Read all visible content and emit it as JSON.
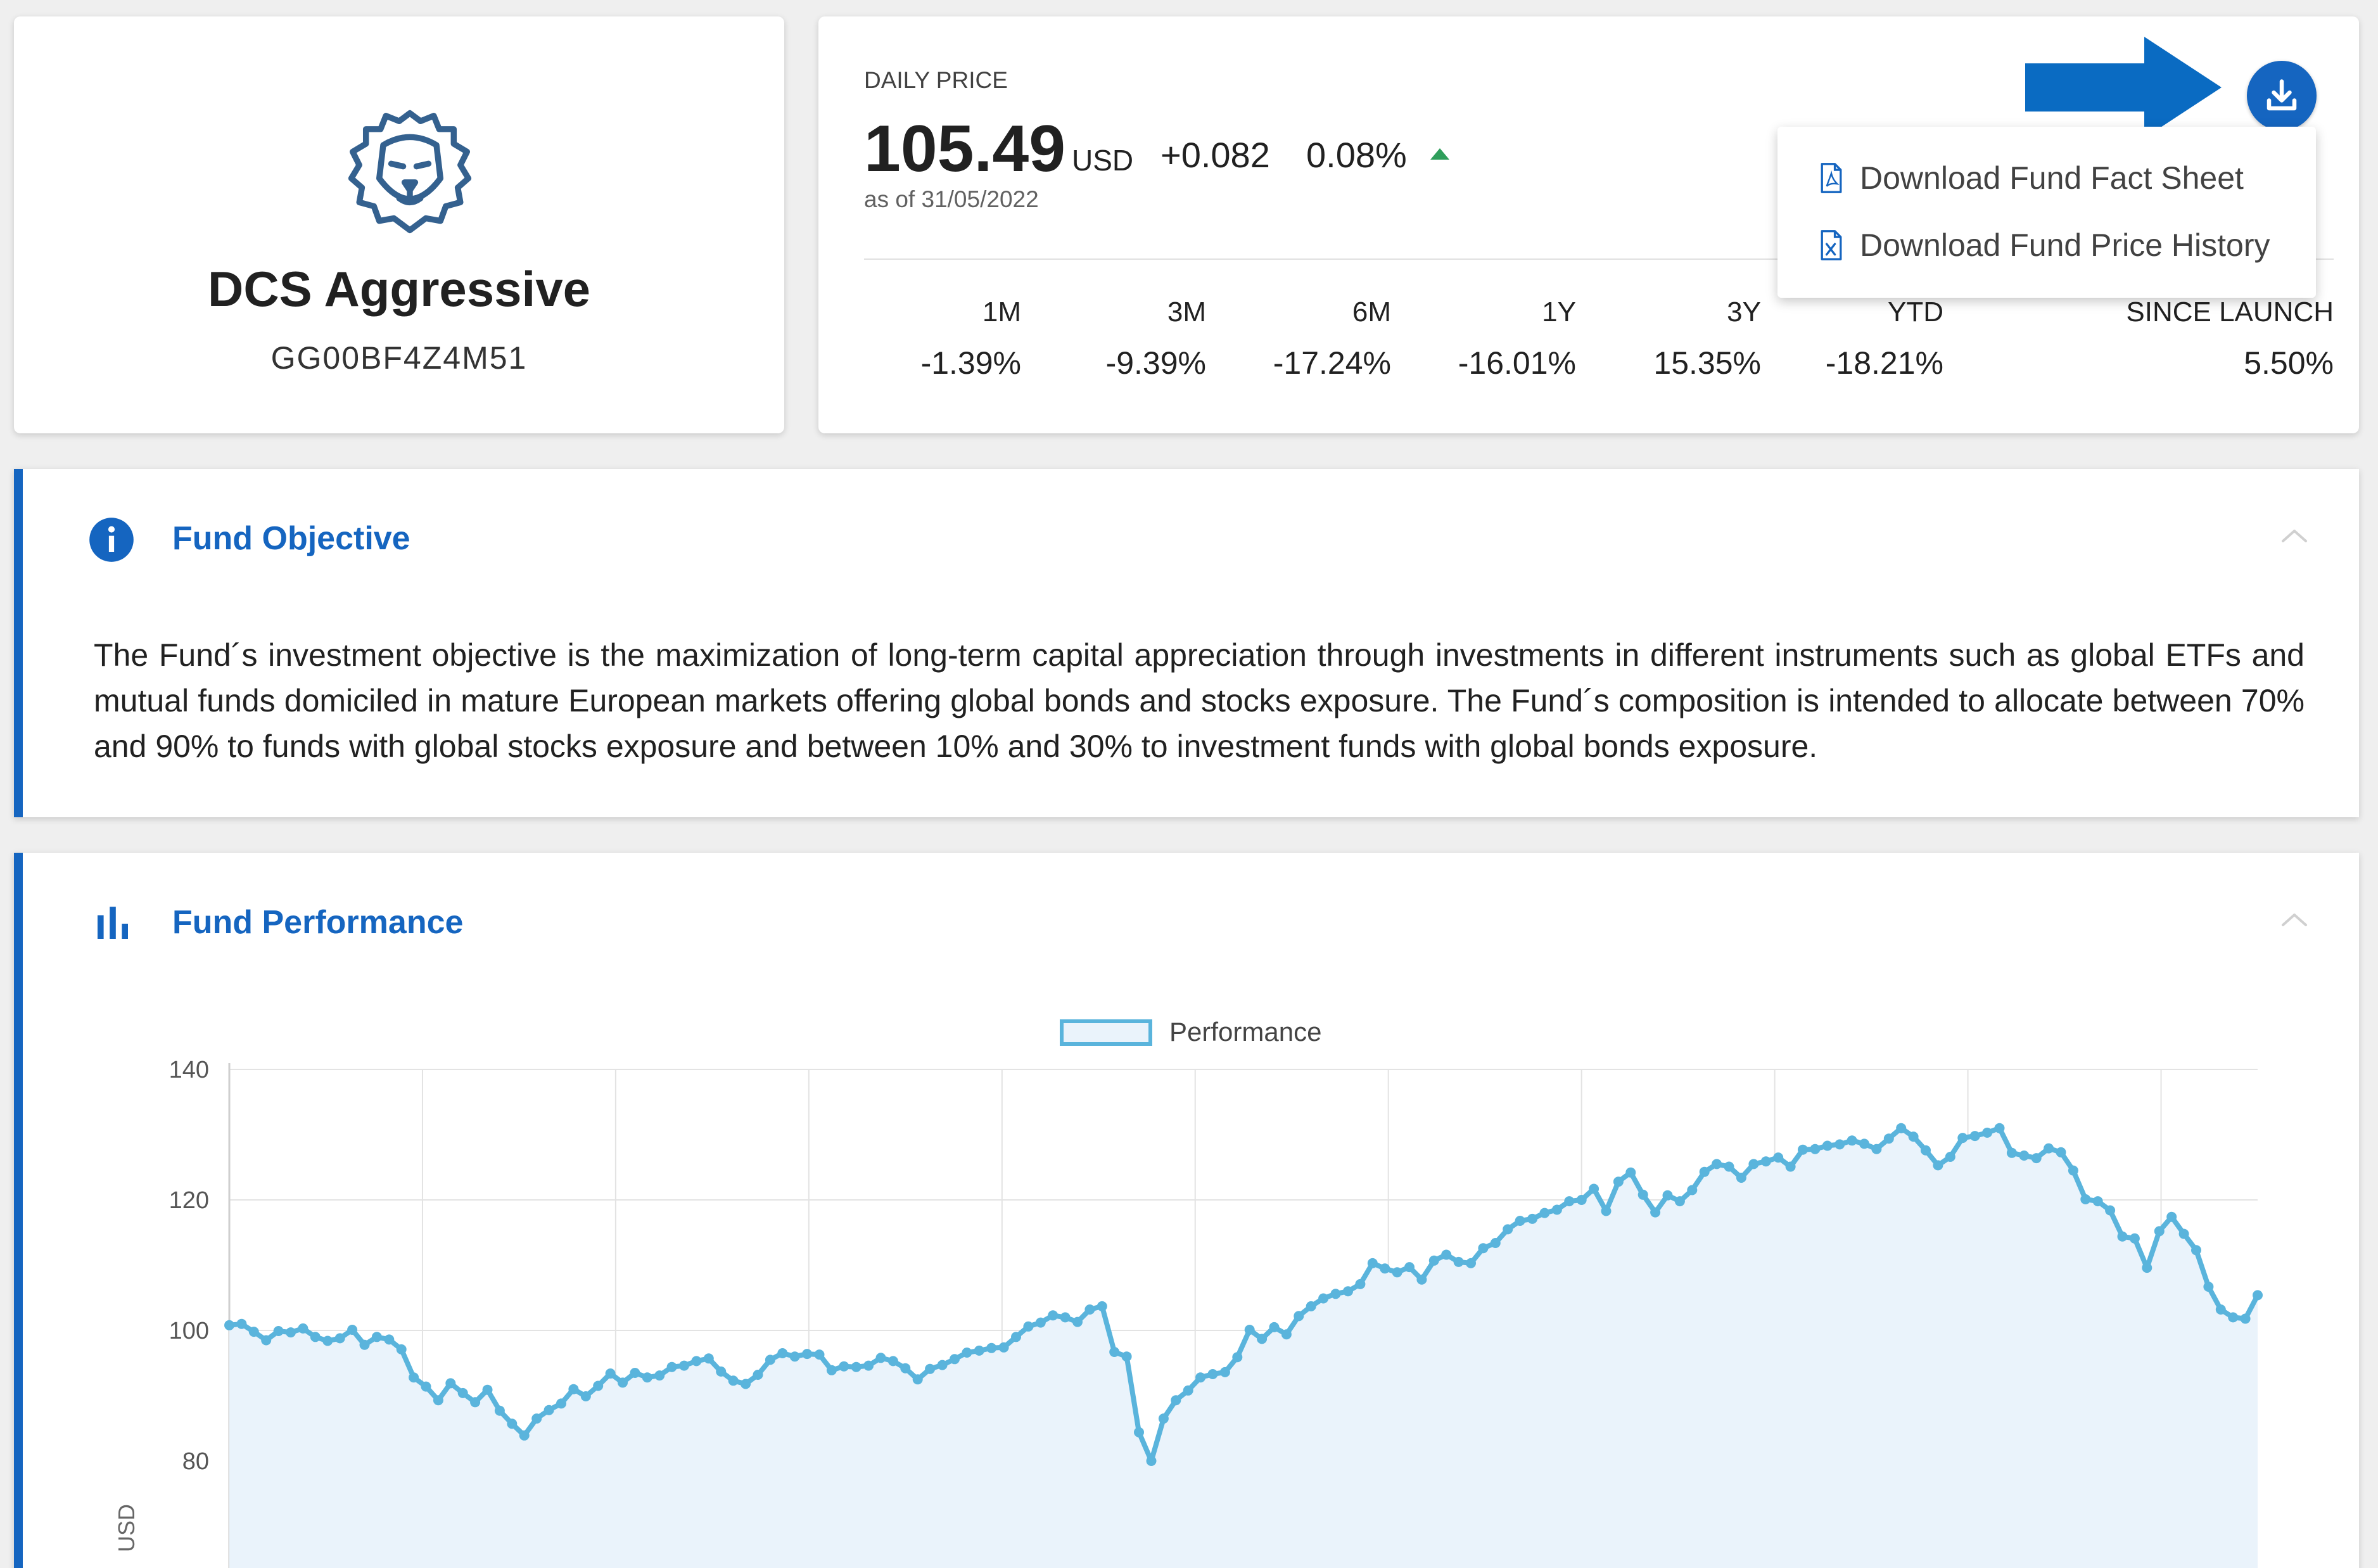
{
  "fund": {
    "name": "DCS Aggressive",
    "isin": "GG00BF4Z4M51"
  },
  "price": {
    "label": "DAILY PRICE",
    "value": "105.49",
    "currency": "USD",
    "change": "+0.082",
    "change_pct": "0.08%",
    "as_of": "as of 31/05/2022",
    "trend": "up"
  },
  "performance_summary": [
    {
      "label": "1M",
      "value": "-1.39%"
    },
    {
      "label": "3M",
      "value": "-9.39%"
    },
    {
      "label": "6M",
      "value": "-17.24%"
    },
    {
      "label": "1Y",
      "value": "-16.01%"
    },
    {
      "label": "3Y",
      "value": "15.35%"
    },
    {
      "label": "YTD",
      "value": "-18.21%"
    },
    {
      "label": "SINCE LAUNCH",
      "value": "5.50%"
    }
  ],
  "download_menu": {
    "button_icon": "download-icon",
    "items": [
      {
        "label": "Download Fund Fact Sheet",
        "icon": "pdf-file-icon"
      },
      {
        "label": "Download Fund Price History",
        "icon": "excel-file-icon"
      }
    ]
  },
  "objective": {
    "title": "Fund Objective",
    "icon": "info-icon",
    "text": "The Fund´s investment objective is the maximization of long-term capital appreciation through investments in different instruments such as global ETFs and mutual funds domiciled in mature European markets offering global bonds and stocks exposure. The Fund´s composition is intended to allocate between 70% and 90% to funds with global stocks exposure and between 10% and 30% to investment funds with global bonds exposure."
  },
  "performance": {
    "title": "Fund Performance",
    "icon": "bar-chart-icon"
  },
  "colors": {
    "accent": "#1565c0",
    "line": "#5ab4dc",
    "area": "#eaf3fb",
    "positive": "#2e9e5b"
  },
  "chart_data": {
    "type": "line",
    "title": "",
    "legend": [
      "Performance"
    ],
    "legend_position": "top-center",
    "xlabel": "",
    "ylabel": "USD",
    "ylim": [
      64,
      140
    ],
    "yticks": [
      80,
      100,
      120,
      140
    ],
    "grid": true,
    "series": [
      {
        "name": "Performance",
        "values": [
          100.8,
          101.0,
          99.8,
          98.5,
          99.9,
          99.7,
          100.3,
          99.0,
          98.4,
          98.8,
          100.1,
          97.8,
          99.0,
          98.6,
          97.1,
          92.8,
          91.4,
          89.3,
          91.9,
          90.4,
          89.0,
          90.9,
          87.7,
          85.7,
          83.9,
          86.5,
          87.8,
          88.8,
          91.0,
          89.9,
          91.5,
          93.4,
          92.0,
          93.5,
          92.8,
          93.1,
          94.4,
          94.6,
          95.3,
          95.7,
          93.7,
          92.3,
          91.8,
          93.2,
          95.5,
          96.5,
          96.0,
          96.4,
          96.3,
          93.9,
          94.5,
          94.4,
          94.6,
          95.8,
          95.3,
          94.2,
          92.5,
          94.1,
          94.7,
          95.6,
          96.6,
          96.9,
          97.3,
          97.4,
          99.0,
          100.6,
          101.2,
          102.3,
          102.0,
          101.3,
          103.2,
          103.7,
          96.7,
          96.0,
          84.4,
          80.0,
          86.5,
          89.3,
          90.8,
          92.8,
          93.3,
          93.6,
          95.9,
          100.1,
          98.7,
          100.5,
          99.4,
          102.2,
          103.7,
          104.9,
          105.6,
          106.0,
          107.1,
          110.3,
          109.5,
          108.9,
          109.7,
          107.8,
          110.7,
          111.6,
          110.5,
          110.3,
          112.6,
          113.4,
          115.5,
          116.8,
          117.1,
          118.0,
          118.5,
          119.8,
          120.0,
          121.7,
          118.3,
          122.8,
          124.2,
          120.8,
          118.1,
          120.7,
          119.8,
          121.5,
          124.3,
          125.5,
          125.1,
          123.4,
          125.5,
          125.9,
          126.5,
          125.1,
          127.7,
          127.8,
          128.3,
          128.5,
          129.1,
          128.6,
          127.8,
          129.4,
          131.0,
          129.7,
          127.6,
          125.3,
          126.6,
          129.5,
          129.8,
          130.3,
          131.0,
          127.2,
          126.8,
          126.4,
          127.9,
          127.3,
          124.5,
          120.1,
          119.8,
          118.4,
          114.4,
          114.1,
          109.6,
          115.2,
          117.4,
          114.8,
          112.3,
          106.7,
          103.2,
          102.0,
          101.8,
          105.4
        ]
      }
    ]
  }
}
